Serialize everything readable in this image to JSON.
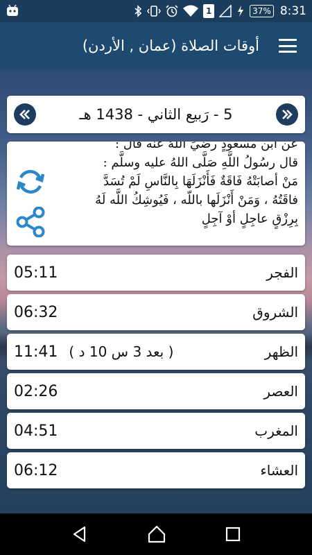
{
  "status_bar": {
    "battery": "37%",
    "time": "8:31",
    "sim": "1"
  },
  "app_bar": {
    "title": "أوقات الصلاة (عمان , الأردن)"
  },
  "date_card": {
    "hijri_date": "5 - رَبيع الثاني - 1438 هـ"
  },
  "hadith": {
    "lines": [
      "عن ابن مسعودٍ رضيَ اللهُ عنه قال :",
      "قال رسُولُ اللَّهِ صَلَّى اللهُ عليه وسلَّم :",
      "مَنْ أصابَتْهُ فَاقَةٌ فَأَنْزَلَهَا بِالنَّاسِ لَمْ تُسَدَّ",
      "فاقَتُهُ ، وَمَنْ أَنْزَلَها باللّه ، فَيُوشِكُ اللَّه لَهُ",
      "بِرِزْقٍ عاجِلٍ أوْ آجِلٍ"
    ]
  },
  "prayers": [
    {
      "name": "الفجر",
      "time": "05:11",
      "countdown": ""
    },
    {
      "name": "الشروق",
      "time": "06:32",
      "countdown": ""
    },
    {
      "name": "الظهر",
      "time": "11:41",
      "countdown": "( بعد 3 س 10 د )"
    },
    {
      "name": "العصر",
      "time": "02:26",
      "countdown": ""
    },
    {
      "name": "المغرب",
      "time": "04:51",
      "countdown": ""
    },
    {
      "name": "العشاء",
      "time": "06:12",
      "countdown": ""
    }
  ],
  "icons": {
    "refresh": "refresh-icon",
    "share": "share-icon",
    "prev": "double-chevron-left-icon",
    "next": "double-chevron-right-icon",
    "menu": "menu-icon"
  },
  "colors": {
    "app_bar": "#1e4a70",
    "status_bar": "#1a3d5e",
    "accent": "#2a88c8",
    "nav_circle": "#1e3c5e"
  }
}
